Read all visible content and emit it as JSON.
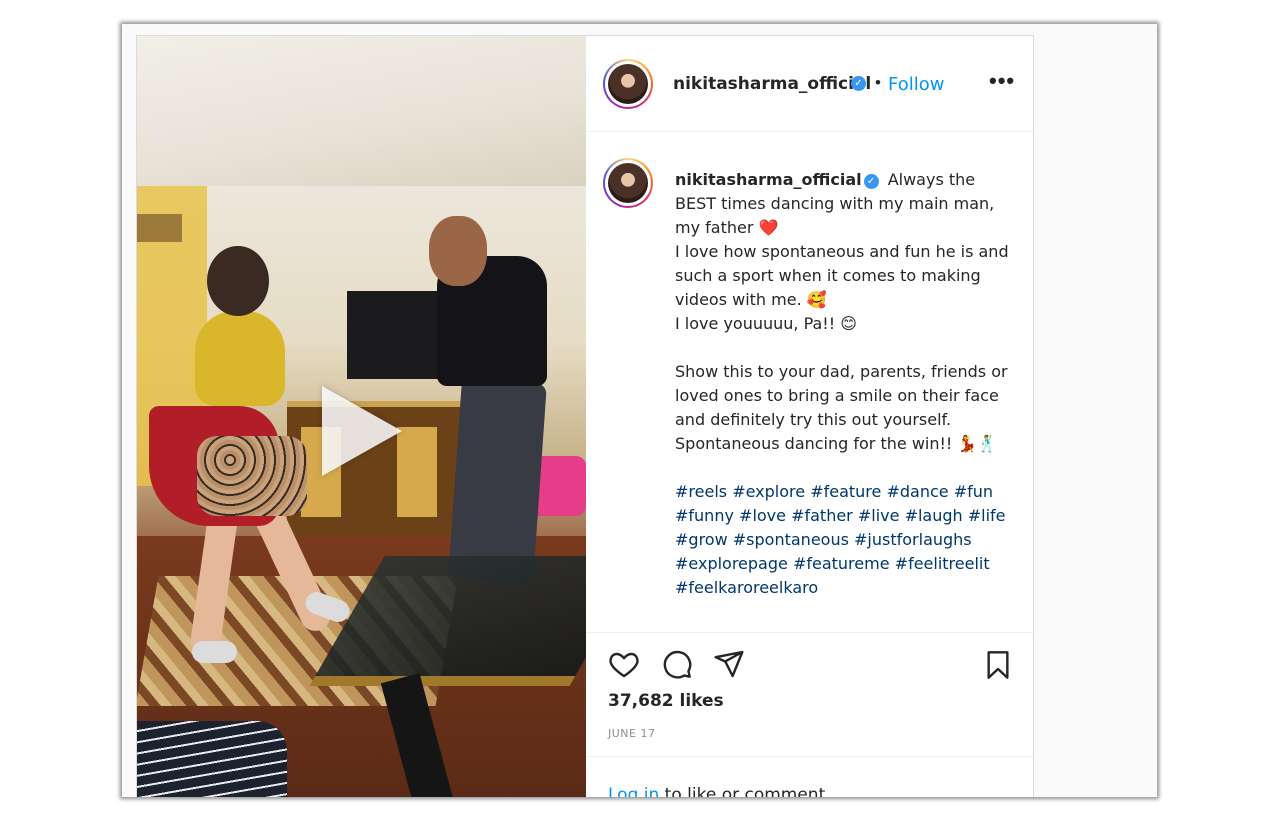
{
  "header": {
    "username": "nikitasharma_official",
    "verified_mark": "✓",
    "separator": "•",
    "follow_label": "Follow",
    "more_label": "•••"
  },
  "caption": {
    "username": "nikitasharma_official",
    "lines": [
      "Always the BEST times dancing with my main man, my father ❤️",
      "I love how spontaneous and fun he is and such a sport when it comes to making videos with me. 🥰",
      "I love youuuuu, Pa!! 😊",
      "Show this to your dad, parents, friends or loved ones to bring a smile on their face and definitely try this out yourself. Spontaneous dancing for the win!! 💃🕺"
    ],
    "hashtags": [
      "#reels",
      "#explore",
      "#feature",
      "#dance",
      "#fun",
      "#funny",
      "#love",
      "#father",
      "#live",
      "#laugh",
      "#life",
      "#grow",
      "#spontaneous",
      "#justforlaughs",
      "#explorepage",
      "#featureme",
      "#feelitreelit",
      "#feelkaroreelkaro"
    ]
  },
  "actions": {
    "likes": "37,682 likes",
    "date": "JUNE 17"
  },
  "login": {
    "link": "Log in",
    "rest": " to like or comment."
  },
  "icons": {
    "like": "heart-icon",
    "comment": "comment-icon",
    "share": "share-icon",
    "save": "bookmark-icon",
    "play": "play-icon"
  },
  "colors": {
    "link_blue": "#0095f6",
    "hashtag": "#00376b",
    "verified": "#3897f0",
    "text": "#262626",
    "muted": "#8e8e8e"
  }
}
